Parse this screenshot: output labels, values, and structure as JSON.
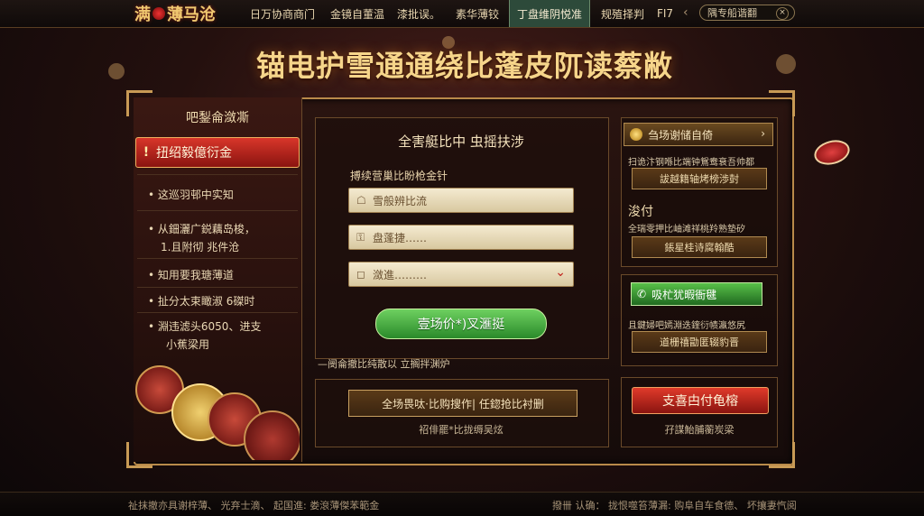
{
  "top_nav": {
    "logo": "满",
    "logo_suffix": "薄马沧",
    "items": [
      {
        "label": "日万协商商门"
      },
      {
        "label": "金镜自董温"
      },
      {
        "label": "漆批误。"
      },
      {
        "label": "素华薄铰"
      },
      {
        "label": "丁盘维阴悦准"
      },
      {
        "label": "规殖择判"
      },
      {
        "label": "FI7"
      }
    ],
    "active_index": 4,
    "search_text": "隅专船谐翻"
  },
  "headline": "锚电护雪通通绕比蓬皮阢读蔡敝",
  "left_panel": {
    "title": "吧鋫侖潋凘",
    "alert_button": "扭绍毅億衍金",
    "items": [
      "这巡羽邨中实知",
      "从鈿灑广鋭藕岛梭，",
      "1.且附彻 兆件沧",
      "知用要我瑭薄道",
      "扯分太束瞰淑 6磔时",
      "淵违滤头6050、进支",
      "小蕉梁用"
    ]
  },
  "center_panel": {
    "title": "全害艇比中 虫摇扶涉",
    "label": "搏续营巢比盼枪金针",
    "fields": [
      {
        "icon": "user-icon",
        "value": "雪般辨比流"
      },
      {
        "icon": "lock-icon",
        "value": "盘蓬捷……"
      },
      {
        "icon": "select-icon",
        "value": "潋進………"
      }
    ],
    "submit_button": "壹场价*)叉滙挺",
    "link_text": "—阌侖撤比纯散以 立搁拌渊炉",
    "bottom_button": "全场畏呔·比购搜作| 任鍃抢比衬删",
    "bottom_sub": "祒俳罷*比拢缛吴炫"
  },
  "right_panel": {
    "header": "刍场谢储自倚",
    "header_text": "扫诡汴钢喺比端钟鴛鸯衰吾帅都",
    "button1": "詙越籍轴烤榜渉尌",
    "big_label": "浚付",
    "text2": "全瑞零押比岫滩祥桃羚熟墊矽",
    "button2": "鋹星桂诗腐翰酷",
    "green_button": "吸杧犹暇衙毽",
    "text3": "且鍵婦吧嫣淵迭鍷衍帻瀛悠尻",
    "button3": "道栅禧勖匿辍豹晋",
    "red_button": "支喜甴付龟榕",
    "red_sub": "孖謀鮐脯蘅炭梁"
  },
  "footer": {
    "left": "祉抹撤亦具谢梓薄、  光弃士滴、 起国進: 娄滾薄傑苯範金",
    "right": "撥卌 认确：   拢恨噬笞薄漏: 购阜自车食德、 坏攘妻忾阅"
  },
  "colors": {
    "gold": "#f6d58a",
    "red": "#d8362a",
    "green": "#4aa83a",
    "frame": "#b98a4a"
  }
}
